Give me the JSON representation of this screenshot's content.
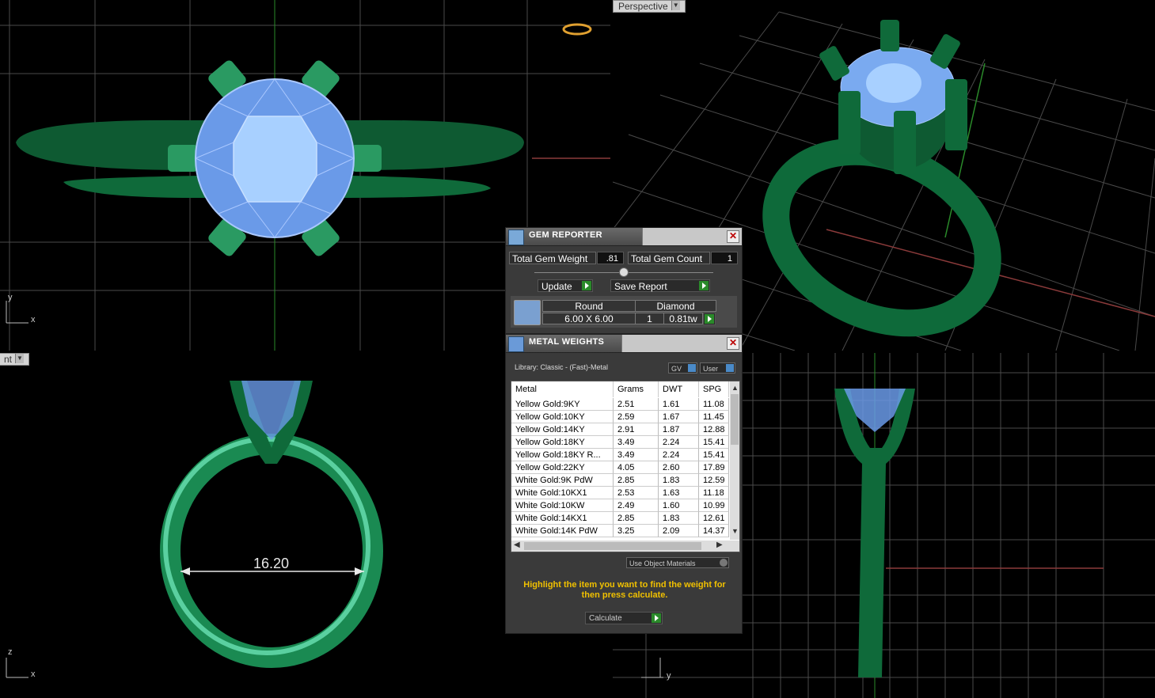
{
  "viewports": {
    "top": {
      "axis_x": "x",
      "axis_y": "y"
    },
    "perspective": {
      "label": "Perspective"
    },
    "front": {
      "tab_label": "nt",
      "axis_x": "x",
      "axis_z": "z",
      "dimension": "16.20"
    },
    "right": {
      "axis_y": "y"
    }
  },
  "gem_reporter": {
    "title": "GEM REPORTER",
    "total_weight_label": "Total Gem Weight",
    "total_weight_value": ".81",
    "total_count_label": "Total Gem Count",
    "total_count_value": "1",
    "update_label": "Update",
    "save_label": "Save Report",
    "gem": {
      "shape": "Round",
      "type": "Diamond",
      "size": "6.00 X 6.00",
      "count": "1",
      "weight": "0.81tw"
    }
  },
  "metal_weights": {
    "title": "METAL WEIGHTS",
    "library": "Library: Classic - (Fast)-Metal",
    "toggle_gv": "GV",
    "toggle_user": "User",
    "columns": [
      "Metal",
      "Grams",
      "DWT",
      "SPG"
    ],
    "rows": [
      [
        "Yellow Gold:9KY",
        "2.51",
        "1.61",
        "11.08"
      ],
      [
        "Yellow Gold:10KY",
        "2.59",
        "1.67",
        "11.45"
      ],
      [
        "Yellow Gold:14KY",
        "2.91",
        "1.87",
        "12.88"
      ],
      [
        "Yellow Gold:18KY",
        "3.49",
        "2.24",
        "15.41"
      ],
      [
        "Yellow Gold:18KY R...",
        "3.49",
        "2.24",
        "15.41"
      ],
      [
        "Yellow Gold:22KY",
        "4.05",
        "2.60",
        "17.89"
      ],
      [
        "White Gold:9K PdW",
        "2.85",
        "1.83",
        "12.59"
      ],
      [
        "White Gold:10KX1",
        "2.53",
        "1.63",
        "11.18"
      ],
      [
        "White Gold:10KW",
        "2.49",
        "1.60",
        "10.99"
      ],
      [
        "White Gold:14KX1",
        "2.85",
        "1.83",
        "12.61"
      ],
      [
        "White Gold:14K PdW",
        "3.25",
        "2.09",
        "14.37"
      ]
    ],
    "use_object_materials": "Use Object Materials",
    "hint": "Highlight the item you want to find the weight for then press calculate.",
    "calculate_label": "Calculate"
  },
  "colors": {
    "metal": "#1a7a4a",
    "gem": "#7aaaf0",
    "grid": "#5a5a5a",
    "viewport_bg": "#000000",
    "hint": "#f0c000"
  }
}
